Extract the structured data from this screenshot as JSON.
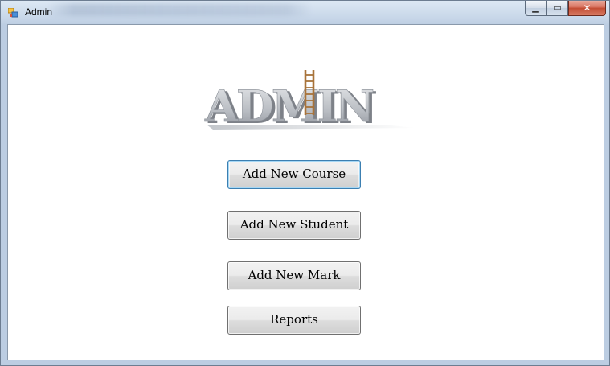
{
  "window": {
    "title": "Admin",
    "icon": "app-window-icon",
    "controls": {
      "minimize": "minimize-icon",
      "maximize": "maximize-icon",
      "close": "close-icon"
    }
  },
  "logo": {
    "text": "ADMIN",
    "colors": {
      "letters": "#b8bcc2",
      "ladder": "#b5824a"
    }
  },
  "buttons": {
    "add_course": "Add New Course",
    "add_student": "Add New Student",
    "add_mark": "Add New Mark",
    "reports": "Reports"
  },
  "colors": {
    "focus_border": "#3c7fb1",
    "client_bg": "#ffffff"
  }
}
